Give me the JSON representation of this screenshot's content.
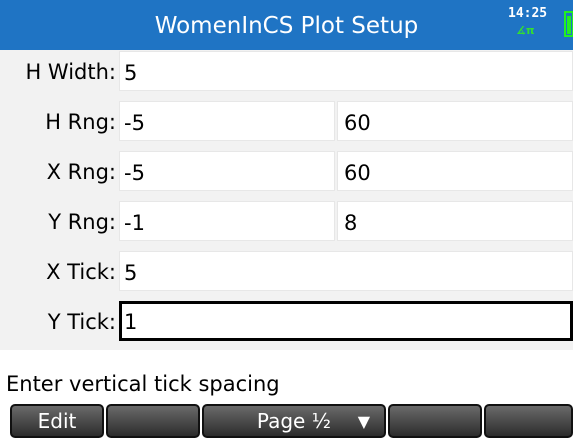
{
  "header": {
    "title": "WomenInCS Plot Setup",
    "time": "14:25",
    "angle_mode": "∡π",
    "battery_icon": "battery-icon"
  },
  "fields": {
    "h_width": {
      "label": "H Width:",
      "value": "5"
    },
    "h_rng": {
      "label": "H Rng:",
      "min": "-5",
      "max": "60"
    },
    "x_rng": {
      "label": "X Rng:",
      "min": "-5",
      "max": "60"
    },
    "y_rng": {
      "label": "Y Rng:",
      "min": "-1",
      "max": "8"
    },
    "x_tick": {
      "label": "X Tick:",
      "value": "5"
    },
    "y_tick": {
      "label": "Y Tick:",
      "value": "1"
    }
  },
  "hint": "Enter vertical tick spacing",
  "menu": {
    "edit": "Edit",
    "page": "Page ½",
    "page_indicator": "▼"
  },
  "colors": {
    "title_bar": "#1f74c4",
    "battery": "#22ee22"
  }
}
